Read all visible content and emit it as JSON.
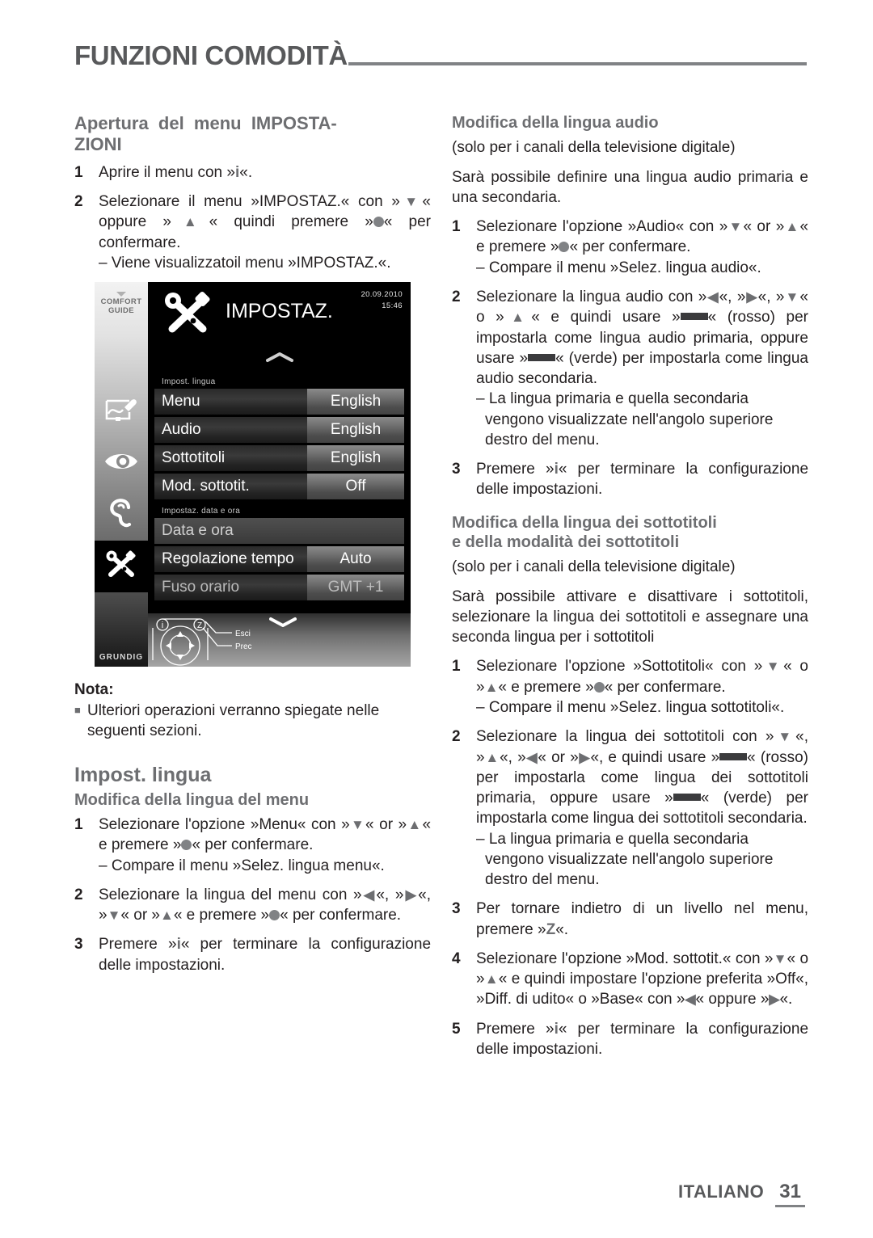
{
  "header": {
    "chapter": "FUNZIONI COMODITÀ"
  },
  "left_column": {
    "heading": "Apertura del menu IMPOSTA-ZIONI",
    "steps": [
      {
        "num": "1",
        "text": "Aprire il menu con »i«."
      },
      {
        "num": "2",
        "text": "Selezionare il menu »IMPOSTAZ.« con »V« oppure »A« quindi premere »●« per confermare.",
        "dash": "– Viene visualizzatoil menu »IMPOSTAZ.«."
      }
    ],
    "note": {
      "title": "Nota:",
      "bullet": "■",
      "text": "Ulteriori operazioni verranno spiegate nelle seguenti sezioni."
    },
    "section2_heading": "Impost. lingua",
    "section2_sub": "Modifica della lingua del menu",
    "section2_steps": [
      {
        "num": "1",
        "text": "Selezionare l'opzione »Menu« con »V« or »A« e premere »●« per confermare.",
        "dash": "– Compare il menu »Selez. lingua menu«."
      },
      {
        "num": "2",
        "text": "Selezionare la lingua del menu con »<«, »>«, »V« or »A« e premere »●« per confermare."
      },
      {
        "num": "3",
        "text": "Premere »i« per terminare la configurazione delle impostazioni."
      }
    ]
  },
  "tv_screenshot": {
    "sidebar": {
      "comfort_label_line1": "COMFORT",
      "comfort_label_line2": "GUIDE",
      "brand": "GRUNDIG",
      "icons": [
        "antenna-setup-icon",
        "eye-icon",
        "ear-icon",
        "tools-icon"
      ],
      "selected_icon": "tools-icon"
    },
    "title": "IMPOSTAZ.",
    "date": "20.09.2010",
    "time": "15:46",
    "group1_label": "Impost. lingua",
    "group2_label": "Impostaz. data e ora",
    "rows": [
      {
        "label": "Menu",
        "value": "English"
      },
      {
        "label": "Audio",
        "value": "English"
      },
      {
        "label": "Sottotitoli",
        "value": "English"
      },
      {
        "label": "Mod. sottotit.",
        "value": "Off"
      }
    ],
    "rows2": [
      {
        "label": "Data e ora",
        "value": ""
      },
      {
        "label": "Regolazione tempo",
        "value": "Auto"
      },
      {
        "label": "Fuso orario",
        "value": "GMT +1"
      }
    ],
    "footer_keys": {
      "exit": "Esci",
      "back": "Prec",
      "info_key": "i",
      "back_key": "Z"
    }
  },
  "right_column": {
    "audio_heading": "Modifica della lingua audio",
    "audio_note": "(solo per i canali della televisione digitale)",
    "audio_intro": "Sarà possibile definire una lingua audio primaria e una secondaria.",
    "audio_steps": [
      {
        "num": "1",
        "text": "Selezionare l'opzione »Audio« con »V« or »A« e premere »●« per confermare.",
        "dash": "– Compare il menu »Selez. lingua audio«."
      },
      {
        "num": "2",
        "text": "Selezionare la lingua audio con »<«, »>«, »V« o »A« e quindi usare »▬« (rosso) per impostarla come lingua audio primaria, oppure usare »▬« (verde) per impostarla come lingua audio secondaria.",
        "dash": "– La lingua primaria e quella secondaria vengono visualizzate nell'angolo superiore destro del menu."
      },
      {
        "num": "3",
        "text": "Premere »i« per terminare la configurazione delle impostazioni."
      }
    ],
    "sub_heading": "Modifica della lingua dei sottotitoli e della modalità dei sottotitoli",
    "sub_note": "(solo per i canali della televisione digitale)",
    "sub_intro": "Sarà possibile attivare e disattivare i sottotitoli, selezionare la lingua dei sottotitoli e assegnare una seconda lingua per i sottotitoli",
    "sub_steps": [
      {
        "num": "1",
        "text": "Selezionare l'opzione »Sottotitoli« con »V« o »A« e premere »●« per confermare.",
        "dash": "– Compare il menu »Selez. lingua sottotitoli«."
      },
      {
        "num": "2",
        "text": "Selezionare la lingua dei sottotitoli con »V«, »A«, »<« or »>«, e quindi usare »▬« (rosso) per impostarla come lingua dei sottotitoli primaria, oppure usare »▬« (verde) per impostarla come lingua dei sottotitoli secondaria.",
        "dash": "– La lingua primaria e quella secondaria vengono visualizzate nell'angolo superiore destro del menu."
      },
      {
        "num": "3",
        "text": "Per tornare indietro di un livello nel menu, premere »Z«."
      },
      {
        "num": "4",
        "text": "Selezionare l'opzione »Mod. sottotit.« con »V« o »A« e quindi impostare l'opzione preferita »Off«, »Diff. di udito« o »Base« con »<« oppure »>«."
      },
      {
        "num": "5",
        "text": "Premere »i« per terminare la configurazione delle impostazioni."
      }
    ]
  },
  "footer": {
    "language": "ITALIANO",
    "page": "31"
  }
}
